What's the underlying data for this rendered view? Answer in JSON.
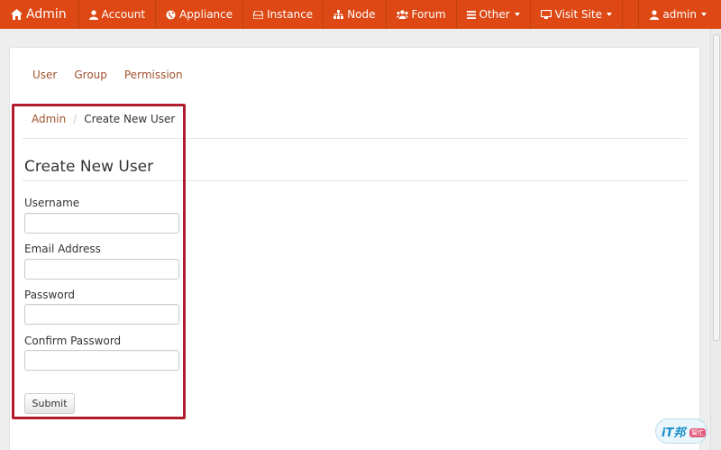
{
  "navbar": {
    "brand": "Admin",
    "items": [
      {
        "label": "Account",
        "icon": "user-icon"
      },
      {
        "label": "Appliance",
        "icon": "globe-icon"
      },
      {
        "label": "Instance",
        "icon": "hdd-icon"
      },
      {
        "label": "Node",
        "icon": "sitemap-icon"
      },
      {
        "label": "Forum",
        "icon": "group-icon"
      },
      {
        "label": "Other",
        "icon": "list-icon"
      },
      {
        "label": "Visit Site",
        "icon": "desktop-icon"
      }
    ],
    "user": "admin"
  },
  "subnav": {
    "items": [
      "User",
      "Group",
      "Permission"
    ]
  },
  "breadcrumb": {
    "root": "Admin",
    "separator": "/",
    "current": "Create New User"
  },
  "form": {
    "title": "Create New User",
    "fields": [
      {
        "label": "Username",
        "value": "",
        "placeholder": ""
      },
      {
        "label": "Email Address",
        "value": "",
        "placeholder": ""
      },
      {
        "label": "Password",
        "value": "",
        "placeholder": ""
      },
      {
        "label": "Confirm Password",
        "value": "",
        "placeholder": ""
      }
    ],
    "submit": "Submit"
  },
  "watermark": {
    "main": "iT邦",
    "sub": "幫忙"
  },
  "colors": {
    "navbar": "#dd4814",
    "link": "#a0522d",
    "highlight": "#b01c2e"
  }
}
